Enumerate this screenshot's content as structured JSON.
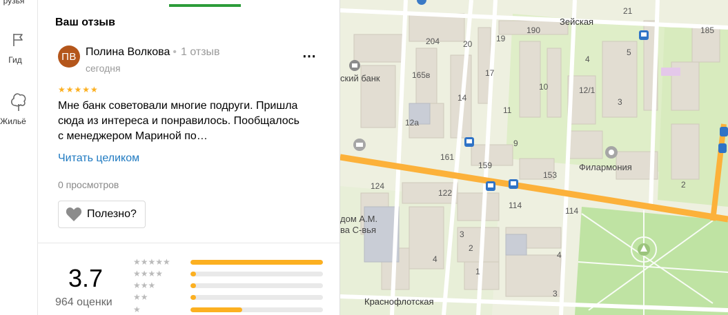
{
  "rail": {
    "items": [
      {
        "label": "рузья"
      },
      {
        "label": "Гид"
      },
      {
        "label": "Жильё"
      }
    ]
  },
  "review_section": {
    "title": "Ваш отзыв",
    "avatar_initials": "ПВ",
    "author": "Полина Волкова",
    "author_reviews": "1 отзыв",
    "date": "сегодня",
    "stars": "★★★★★",
    "text": "Мне банк советовали многие подруги. Пришла сюда из интереса и понравилось. Пообщалось с менеджером Мариной по…",
    "read_more": "Читать целиком",
    "views": "0 просмотров",
    "useful_label": "Полезно?"
  },
  "rating": {
    "value": "3.7",
    "count": "964 оценки",
    "distribution": [
      {
        "stars": "★★★★★",
        "fraction": 1.0
      },
      {
        "stars": "★★★★",
        "fraction": 0.04
      },
      {
        "stars": "★★★",
        "fraction": 0.04
      },
      {
        "stars": "★★",
        "fraction": 0.04
      },
      {
        "stars": "★",
        "fraction": 0.39
      }
    ]
  },
  "map": {
    "street_labels": [
      "Зейская",
      "Краснофлотская"
    ],
    "poi_labels": [
      "ский банк",
      "Филармония",
      "дом А.М.",
      "ва С-вья"
    ],
    "building_numbers": [
      "21",
      "185",
      "190",
      "204",
      "20",
      "19",
      "5",
      "4",
      "165в",
      "17",
      "10",
      "12/1",
      "14",
      "11",
      "3",
      "12а",
      "9",
      "161",
      "159",
      "153",
      "124",
      "122",
      "114",
      "114",
      "2",
      "3",
      "4",
      "2",
      "1",
      "4",
      "3"
    ]
  },
  "colors": {
    "accent_green": "#2c9c3a",
    "star_gold": "#fcb021",
    "link_blue": "#1f7ac1",
    "avatar_brown": "#b4561b",
    "road_orange": "#fcb13a"
  }
}
